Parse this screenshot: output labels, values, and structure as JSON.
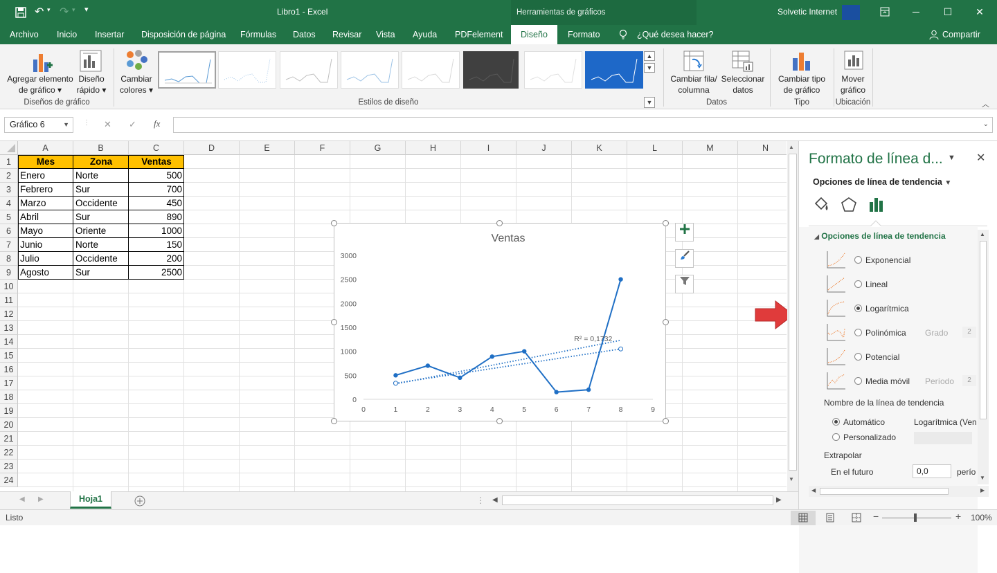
{
  "window": {
    "file_title": "Libro1",
    "separator": "-",
    "app_name": "Excel",
    "context_header": "Herramientas de gráficos",
    "account": "Solvetic Internet",
    "minimize": "─",
    "restore": "☐",
    "close": "✕"
  },
  "tabs": [
    "Archivo",
    "Inicio",
    "Insertar",
    "Disposición de página",
    "Fórmulas",
    "Datos",
    "Revisar",
    "Vista",
    "Ayuda",
    "PDFelement",
    "Diseño",
    "Formato"
  ],
  "tell_me": "¿Qué desea hacer?",
  "share": "Compartir",
  "ribbon": {
    "add_element": [
      "Agregar elemento",
      "de gráfico ▾"
    ],
    "quick_layout": [
      "Diseño",
      "rápido ▾"
    ],
    "group_layouts": "Diseños de gráfico",
    "change_colors": [
      "Cambiar",
      "colores ▾"
    ],
    "group_styles": "Estilos de diseño",
    "switch_row_col": [
      "Cambiar fila/",
      "columna"
    ],
    "select_data": [
      "Seleccionar",
      "datos"
    ],
    "group_data": "Datos",
    "change_type": [
      "Cambiar tipo",
      "de gráfico"
    ],
    "group_type": "Tipo",
    "move_chart": [
      "Mover",
      "gráfico"
    ],
    "group_location": "Ubicación"
  },
  "formula_bar": {
    "name_box": "Gráfico 6",
    "cancel": "✕",
    "enter": "✓",
    "fx": "fx"
  },
  "columns": [
    "A",
    "B",
    "C",
    "D",
    "E",
    "F",
    "G",
    "H",
    "I",
    "J",
    "K",
    "L",
    "M",
    "N"
  ],
  "rows": [
    "1",
    "2",
    "3",
    "4",
    "5",
    "6",
    "7",
    "8",
    "9",
    "10",
    "11",
    "12",
    "13",
    "14",
    "15",
    "16",
    "17",
    "18",
    "19",
    "20",
    "21",
    "22",
    "23",
    "24"
  ],
  "table": {
    "headers": [
      "Mes",
      "Zona",
      "Ventas"
    ],
    "rows": [
      [
        "Enero",
        "Norte",
        "500"
      ],
      [
        "Febrero",
        "Sur",
        "700"
      ],
      [
        "Marzo",
        "Occidente",
        "450"
      ],
      [
        "Abril",
        "Sur",
        "890"
      ],
      [
        "Mayo",
        "Oriente",
        "1000"
      ],
      [
        "Junio",
        "Norte",
        "150"
      ],
      [
        "Julio",
        "Occidente",
        "200"
      ],
      [
        "Agosto",
        "Sur",
        "2500"
      ]
    ]
  },
  "chart_data": {
    "type": "line",
    "title": "Ventas",
    "x": [
      1,
      2,
      3,
      4,
      5,
      6,
      7,
      8
    ],
    "series": [
      {
        "values": [
          500,
          700,
          450,
          890,
          1000,
          150,
          200,
          2500
        ],
        "color": "#1f6fc5"
      }
    ],
    "trendlines": [
      {
        "kind": "linear",
        "from": [
          1,
          320
        ],
        "to": [
          8,
          1230
        ]
      },
      {
        "kind": "logarithmic",
        "from": [
          1,
          335
        ],
        "to": [
          8,
          1050
        ]
      }
    ],
    "r_squared_label": "R² = 0,1732",
    "xlim": [
      0,
      9
    ],
    "ylim": [
      0,
      3000
    ],
    "xticks": [
      "0",
      "1",
      "2",
      "3",
      "4",
      "5",
      "6",
      "7",
      "8",
      "9"
    ],
    "yticks": [
      "0",
      "500",
      "1000",
      "1500",
      "2000",
      "2500",
      "3000"
    ],
    "grid": false,
    "legend": "none"
  },
  "sheet_tab": "Hoja1",
  "pane": {
    "title": "Formato de línea d...",
    "subtitle": "Opciones de línea de tendencia",
    "section": "Opciones de línea de tendencia",
    "options": [
      {
        "label": "Exponencial",
        "selected": false
      },
      {
        "label": "Lineal",
        "selected": false
      },
      {
        "label": "Logarítmica",
        "selected": true
      },
      {
        "label": "Polinómica",
        "selected": false,
        "extra": "Grado",
        "value": "2"
      },
      {
        "label": "Potencial",
        "selected": false
      },
      {
        "label": "Media móvil",
        "selected": false,
        "extra": "Período",
        "value": "2"
      }
    ],
    "name_label": "Nombre de la línea de tendencia",
    "automatic": "Automático",
    "automatic_value": "Logarítmica (Ven",
    "custom": "Personalizado",
    "extrapolate": "Extrapolar",
    "forward": "En el futuro",
    "forward_value": "0,0",
    "forward_unit": "perío"
  },
  "status": {
    "ready": "Listo",
    "zoom": "100%"
  }
}
